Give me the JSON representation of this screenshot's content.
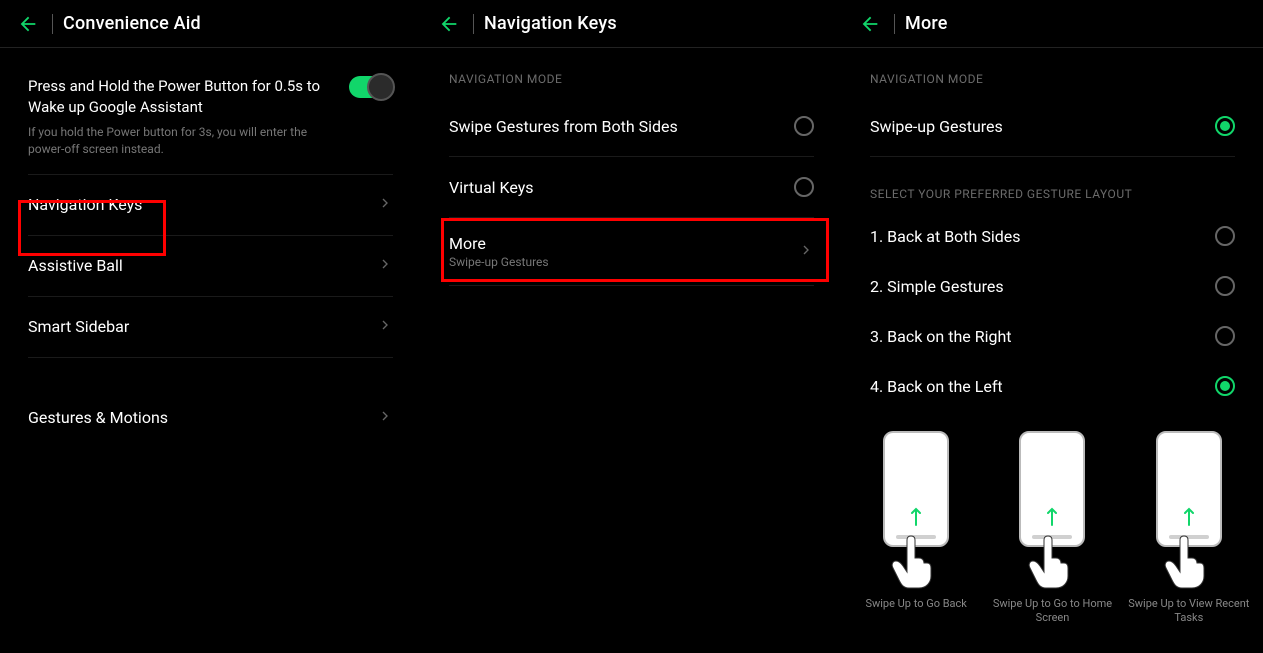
{
  "panel1": {
    "title": "Convenience Aid",
    "power_row": {
      "label": "Press and Hold the Power Button for 0.5s to Wake up Google Assistant",
      "desc": "If you hold the Power button for 3s, you will enter the power-off screen instead."
    },
    "nav_keys": "Navigation Keys",
    "assistive_ball": "Assistive Ball",
    "smart_sidebar": "Smart Sidebar",
    "gestures_motions": "Gestures & Motions"
  },
  "panel2": {
    "title": "Navigation Keys",
    "section": "NAVIGATION MODE",
    "swipe_both": "Swipe Gestures from Both Sides",
    "virtual_keys": "Virtual Keys",
    "more": "More",
    "more_sub": "Swipe-up Gestures"
  },
  "panel3": {
    "title": "More",
    "section1": "NAVIGATION MODE",
    "swipe_up": "Swipe-up Gestures",
    "section2": "SELECT YOUR PREFERRED GESTURE LAYOUT",
    "opt1": "1. Back at Both Sides",
    "opt2": "2. Simple Gestures",
    "opt3": "3. Back on the Right",
    "opt4": "4. Back on the Left",
    "cap1": "Swipe Up to Go Back",
    "cap2": "Swipe Up to Go to Home Screen",
    "cap3": "Swipe Up to View Recent Tasks"
  }
}
